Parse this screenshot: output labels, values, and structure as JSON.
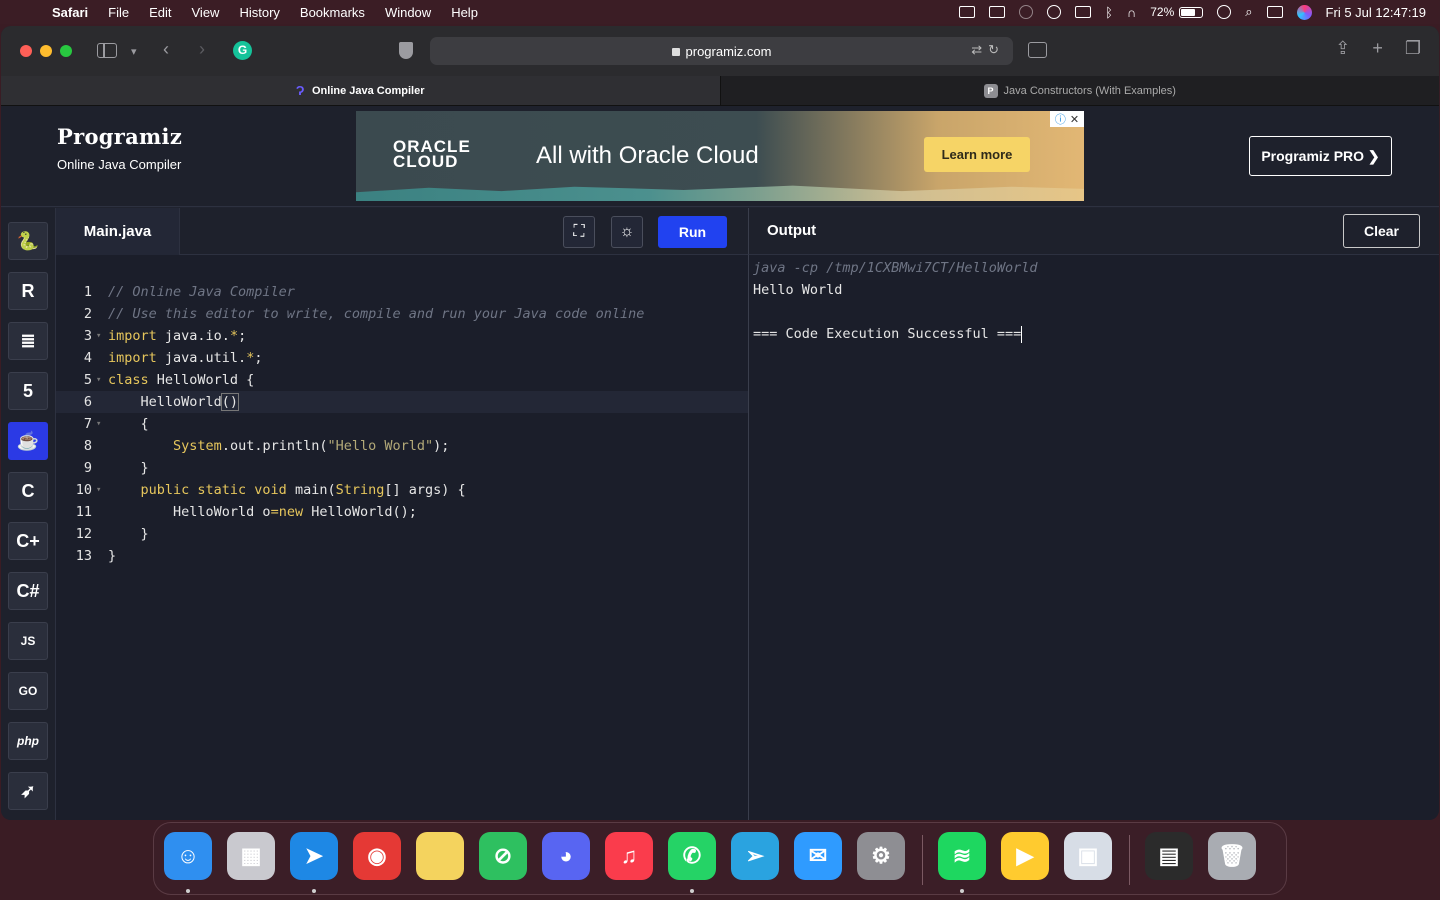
{
  "menubar": {
    "app_name": "Safari",
    "items": [
      "File",
      "Edit",
      "View",
      "History",
      "Bookmarks",
      "Window",
      "Help"
    ],
    "battery": "72%",
    "battery_level": 0.72,
    "clock": "Fri 5 Jul  12:47:19"
  },
  "browser": {
    "url": "programiz.com",
    "tabs": [
      {
        "label": "Online Java Compiler",
        "active": true
      },
      {
        "label": "Java Constructors (With Examples)",
        "active": false,
        "favicon": "P"
      }
    ]
  },
  "site": {
    "logo": "Programiz",
    "subtitle": "Online Java Compiler",
    "pro_button": "Programiz PRO ❯"
  },
  "ad": {
    "brand_line1": "ORACLE",
    "brand_line2": "CLOUD",
    "tagline": "All with Oracle Cloud",
    "cta": "Learn more"
  },
  "languages": [
    {
      "name": "python-icon",
      "label": "",
      "glyph": "🐍"
    },
    {
      "name": "r-icon",
      "label": "R"
    },
    {
      "name": "sql-icon",
      "label": "≣"
    },
    {
      "name": "html5-icon",
      "label": "5"
    },
    {
      "name": "java-icon",
      "label": "☕",
      "active": true
    },
    {
      "name": "c-icon",
      "label": "C"
    },
    {
      "name": "cpp-icon",
      "label": "C+"
    },
    {
      "name": "csharp-icon",
      "label": "C#"
    },
    {
      "name": "javascript-icon",
      "label": "JS"
    },
    {
      "name": "go-icon",
      "label": "GO"
    },
    {
      "name": "php-icon",
      "label": "php"
    },
    {
      "name": "swift-icon",
      "label": "➶"
    }
  ],
  "editor": {
    "filename": "Main.java",
    "fullscreen_icon": "⛶",
    "theme_icon": "☼",
    "run_label": "Run",
    "lines": [
      {
        "n": "1",
        "fold": "",
        "tokens": [
          {
            "t": "// Online Java Compiler",
            "c": "c-com"
          }
        ]
      },
      {
        "n": "2",
        "fold": "",
        "tokens": [
          {
            "t": "// Use this editor to write, compile and run your Java code online",
            "c": "c-com"
          }
        ]
      },
      {
        "n": "3",
        "fold": "▾",
        "tokens": [
          {
            "t": "import",
            "c": "c-kw"
          },
          {
            "t": " java.io.",
            "c": ""
          },
          {
            "t": "*",
            "c": "c-op"
          },
          {
            "t": ";",
            "c": ""
          }
        ]
      },
      {
        "n": "4",
        "fold": "",
        "tokens": [
          {
            "t": "import",
            "c": "c-kw"
          },
          {
            "t": " java.util.",
            "c": ""
          },
          {
            "t": "*",
            "c": "c-op"
          },
          {
            "t": ";",
            "c": ""
          }
        ]
      },
      {
        "n": "5",
        "fold": "▾",
        "tokens": [
          {
            "t": "class",
            "c": "c-kw"
          },
          {
            "t": " HelloWorld {",
            "c": ""
          }
        ]
      },
      {
        "n": "6",
        "fold": "",
        "hl": true,
        "tokens": [
          {
            "t": "    HelloWorld",
            "c": ""
          },
          {
            "t": "()",
            "c": "paren-box"
          }
        ]
      },
      {
        "n": "7",
        "fold": "▾",
        "tokens": [
          {
            "t": "    {",
            "c": ""
          }
        ]
      },
      {
        "n": "8",
        "fold": "",
        "tokens": [
          {
            "t": "        ",
            "c": ""
          },
          {
            "t": "System",
            "c": "c-cls"
          },
          {
            "t": ".out.println(",
            "c": ""
          },
          {
            "t": "\"Hello World\"",
            "c": "c-str"
          },
          {
            "t": ");",
            "c": ""
          }
        ]
      },
      {
        "n": "9",
        "fold": "",
        "tokens": [
          {
            "t": "    }",
            "c": ""
          }
        ]
      },
      {
        "n": "10",
        "fold": "▾",
        "tokens": [
          {
            "t": "    ",
            "c": ""
          },
          {
            "t": "public static void",
            "c": "c-kw"
          },
          {
            "t": " main(",
            "c": ""
          },
          {
            "t": "String",
            "c": "c-cls"
          },
          {
            "t": "[] args) {",
            "c": ""
          }
        ]
      },
      {
        "n": "11",
        "fold": "",
        "tokens": [
          {
            "t": "        HelloWorld o",
            "c": ""
          },
          {
            "t": "=new",
            "c": "c-kw"
          },
          {
            "t": " HelloWorld();",
            "c": ""
          }
        ]
      },
      {
        "n": "12",
        "fold": "",
        "tokens": [
          {
            "t": "    }",
            "c": ""
          }
        ]
      },
      {
        "n": "13",
        "fold": "",
        "tokens": [
          {
            "t": "}",
            "c": ""
          }
        ]
      }
    ]
  },
  "output": {
    "title": "Output",
    "clear_label": "Clear",
    "lines": [
      {
        "text": "java -cp /tmp/1CXBMwi7CT/HelloWorld",
        "kind": "cmd"
      },
      {
        "text": "Hello World",
        "kind": "out"
      },
      {
        "text": "",
        "kind": "out"
      },
      {
        "text": "=== Code Execution Successful ===",
        "kind": "out",
        "cursor": true
      }
    ]
  },
  "dock": [
    {
      "name": "finder-icon",
      "glyph": "☺",
      "bg": "#2f8ff0",
      "dot": true
    },
    {
      "name": "launchpad-icon",
      "glyph": "▦",
      "bg": "#c9c9cf"
    },
    {
      "name": "safari-icon",
      "glyph": "➤",
      "bg": "#1e88e5",
      "dot": true
    },
    {
      "name": "chrome-icon",
      "glyph": "◉",
      "bg": "#e53935"
    },
    {
      "name": "notes-icon",
      "glyph": "",
      "bg": "#f4d35e"
    },
    {
      "name": "blocker-icon",
      "glyph": "⊘",
      "bg": "#2ec060"
    },
    {
      "name": "discord-icon",
      "glyph": "◕",
      "bg": "#5865f2"
    },
    {
      "name": "music-icon",
      "glyph": "♫",
      "bg": "#fa3c4c"
    },
    {
      "name": "whatsapp-icon",
      "glyph": "✆",
      "bg": "#25d366",
      "dot": true
    },
    {
      "name": "telegram-icon",
      "glyph": "➢",
      "bg": "#2aa3e0"
    },
    {
      "name": "mail-icon",
      "glyph": "✉",
      "bg": "#2f9bff"
    },
    {
      "name": "system-settings-icon",
      "glyph": "⚙",
      "bg": "#8e8e93"
    },
    {
      "name": "spotify-icon",
      "glyph": "≋",
      "bg": "#1ed760",
      "dot": true
    },
    {
      "name": "video-player-icon",
      "glyph": "▶",
      "bg": "#ffcb2f"
    },
    {
      "name": "preview-icon",
      "glyph": "▣",
      "bg": "#d7dde6"
    },
    {
      "name": "terminal-whatsapp-icon",
      "glyph": "▤",
      "bg": "#2b2b2b"
    },
    {
      "name": "trash-icon",
      "glyph": "🗑",
      "bg": "#a9acb2"
    }
  ],
  "colors": {
    "accent": "#2142f0",
    "java_active": "#2b3ae5",
    "ad_cta": "#f6d466"
  }
}
